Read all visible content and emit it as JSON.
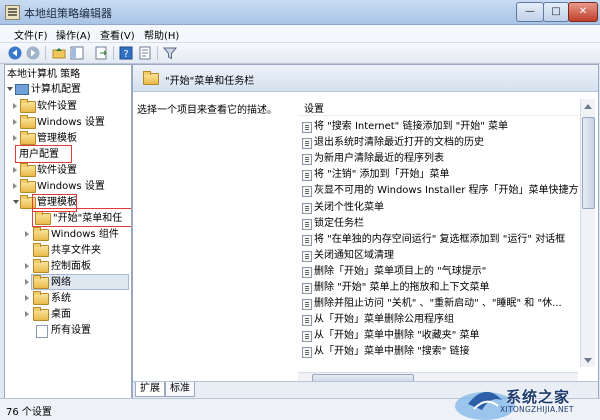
{
  "window": {
    "title": "本地组策略编辑器"
  },
  "controls": {
    "minimize": "—",
    "maximize": "□",
    "close": "✕"
  },
  "menu": [
    "文件(F)",
    "操作(A)",
    "查看(V)",
    "帮助(H)"
  ],
  "toolbar": [
    "back-arrow-icon",
    "forward-arrow-icon",
    "up-folder-icon",
    "show-hide-tree-icon",
    "export-list-icon",
    "help-icon",
    "properties-icon",
    "filter-icon"
  ],
  "tree": {
    "root": "本地计算机 策略",
    "computer_config": "计算机配置",
    "software_settings_1": "软件设置",
    "windows_settings_1": "Windows 设置",
    "admin_templates_1": "管理模板",
    "user_config": "用户配置",
    "software_settings_2": "软件设置",
    "windows_settings_2": "Windows 设置",
    "admin_templates_2": "管理模板",
    "start_menu": "\"开始\"菜单和任",
    "windows_components": "Windows 组件",
    "shared_folders": "共享文件夹",
    "control_panel": "控制面板",
    "network": "网络",
    "system": "系统",
    "desktop": "桌面",
    "all_settings": "所有设置"
  },
  "right_pane": {
    "title": "\"开始\"菜单和任务栏",
    "description": "选择一个项目来查看它的描述。",
    "column_header": "设置",
    "rows": [
      "将 \"搜索 Internet\" 链接添加到 \"开始\" 菜单",
      "退出系统时清除最近打开的文档的历史",
      "为新用户清除最近的程序列表",
      "将 \"注销\" 添加到「开始」菜单",
      "灰显不可用的 Windows Installer 程序「开始」菜单快捷方...",
      "关闭个性化菜单",
      "锁定任务栏",
      "将 \"在单独的内存空间运行\" 复选框添加到 \"运行\" 对话框",
      "关闭通知区域清理",
      "删除「开始」菜单项目上的 \"气球提示\"",
      "删除 \"开始\" 菜单上的拖放和上下文菜单",
      "删除并阻止访问 \"关机\" 、\"重新启动\" 、\"睡眠\" 和 \"休...",
      "从「开始」菜单删除公用程序组",
      "从「开始」菜单中删除 \"收藏夹\" 菜单",
      "从「开始」菜单中删除 \"搜索\" 链接"
    ]
  },
  "tabs": [
    "扩展",
    "标准"
  ],
  "status": "76 个设置",
  "watermark": {
    "main": "系统之家",
    "url": "XITONGZHIJIA.NET"
  },
  "colors": {
    "highlight_box": "#e03c3c",
    "title_gradient_top": "#c9dcf2",
    "watermark_text": "#1e3c6e"
  }
}
